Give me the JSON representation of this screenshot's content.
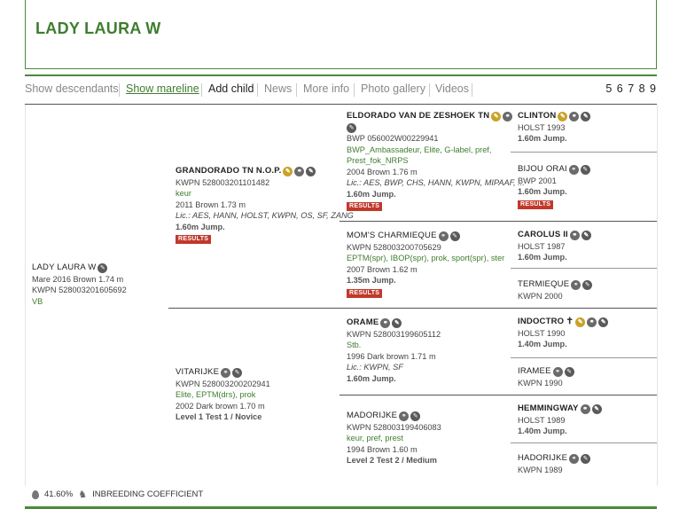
{
  "title": "LADY LAURA W",
  "nav": {
    "show_descendants": "Show descendants",
    "show_mareline": "Show mareline",
    "add_child": "Add child",
    "news": "News",
    "more_info": "More info",
    "photo_gallery": "Photo gallery",
    "videos": "Videos",
    "pages": "5 6 7 8 9"
  },
  "subject": {
    "name": "LADY LAURA W",
    "line1": "Mare 2016 Brown 1.74 m",
    "line2": "KWPN 528003201605692",
    "line3": "VB"
  },
  "sire": {
    "name": "GRANDORADO TN N.O.P.",
    "reg": "KWPN 528003201101482",
    "pred": "keur",
    "birth": "2011 Brown 1.73 m",
    "lic": "Lic.: AES, HANN, HOLST, KWPN, OS, SF, ZANG",
    "perf": "1.60m Jump.",
    "badge": "RESULTS"
  },
  "dam": {
    "name": "VITARIJKE",
    "reg": "KWPN 528003200202941",
    "pred": "Elite, EPTM(drs), prok",
    "birth": "2002 Dark brown 1.70 m",
    "perf": "Level 1 Test 1 / Novice"
  },
  "ss": {
    "name": "ELDORADO VAN DE ZESHOEK TN",
    "reg": "BWP 056002W00229941",
    "pred1": "BWP_Ambassadeur, Elite, G-label, pref,",
    "pred2": "Prest_fok_NRPS",
    "birth": "2004 Brown 1.76 m",
    "lic": "Lic.: AES, BWP, CHS, HANN, KWPN, MIPAAF, ...",
    "perf": "1.60m Jump.",
    "badge": "RESULTS"
  },
  "sd": {
    "name": "MOM'S CHARMIEQUE",
    "reg": "KWPN 528003200705629",
    "pred": "EPTM(spr), IBOP(spr), prok, sport(spr), ster",
    "birth": "2007 Brown 1.62 m",
    "perf": "1.35m Jump.",
    "badge": "RESULTS"
  },
  "ds": {
    "name": "ORAME",
    "reg": "KWPN 528003199605112",
    "pred": "Stb.",
    "birth": "1996 Dark brown 1.71 m",
    "lic": "Lic.: KWPN, SF",
    "perf": "1.60m Jump."
  },
  "dd": {
    "name": "MADORIJKE",
    "reg": "KWPN 528003199406083",
    "pred": "keur, pref, prest",
    "birth": "1994 Brown 1.60 m",
    "perf": "Level 2 Test 2 / Medium"
  },
  "g1": {
    "name": "CLINTON",
    "reg": "HOLST 1993",
    "perf": "1.60m Jump."
  },
  "g2": {
    "name": "BIJOU ORAI",
    "reg": "BWP 2001",
    "perf": "1.60m Jump.",
    "badge": "RESULTS"
  },
  "g3": {
    "name": "CAROLUS II",
    "reg": "HOLST 1987",
    "perf": "1.60m Jump."
  },
  "g4": {
    "name": "TERMIEQUE",
    "reg": "KWPN 2000"
  },
  "g5": {
    "name": "INDOCTRO",
    "reg": "HOLST 1990",
    "perf": "1.40m Jump."
  },
  "g6": {
    "name": "IRAMEE",
    "reg": "KWPN 1990"
  },
  "g7": {
    "name": "HEMMINGWAY",
    "reg": "HOLST 1989",
    "perf": "1.40m Jump."
  },
  "g8": {
    "name": "HADORIJKE",
    "reg": "KWPN 1989"
  },
  "footer": {
    "inbreeding_value": "41.60%",
    "inbreeding_label": "INBREEDING COEFFICIENT"
  }
}
